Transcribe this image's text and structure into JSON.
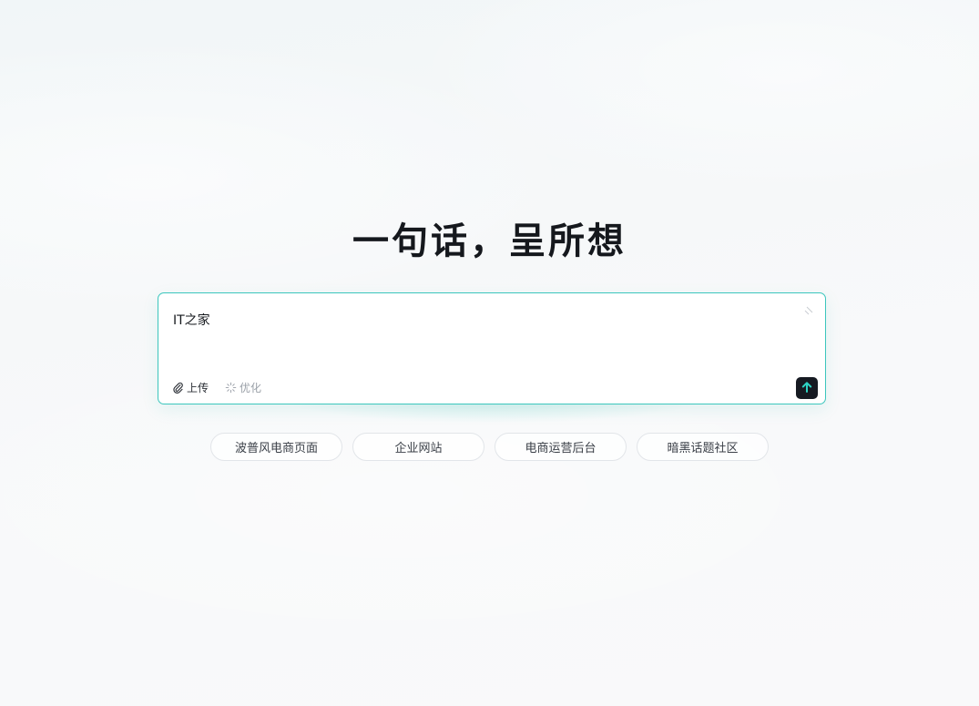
{
  "hero": {
    "title": "一句话，呈所想"
  },
  "composer": {
    "input_value": "IT之家",
    "upload_label": "上传",
    "optimize_label": "优化"
  },
  "icons": {
    "upload": "paperclip-icon",
    "optimize": "sparkle-icon",
    "send": "arrow-up-icon",
    "resize": "resize-handle-icon"
  },
  "colors": {
    "accent": "#3cc6bd",
    "send_bg": "#161a22",
    "send_arrow": "#2ed3c4"
  },
  "suggestions": [
    {
      "label": "波普风电商页面"
    },
    {
      "label": "企业网站"
    },
    {
      "label": "电商运营后台"
    },
    {
      "label": "暗黑话题社区"
    }
  ]
}
